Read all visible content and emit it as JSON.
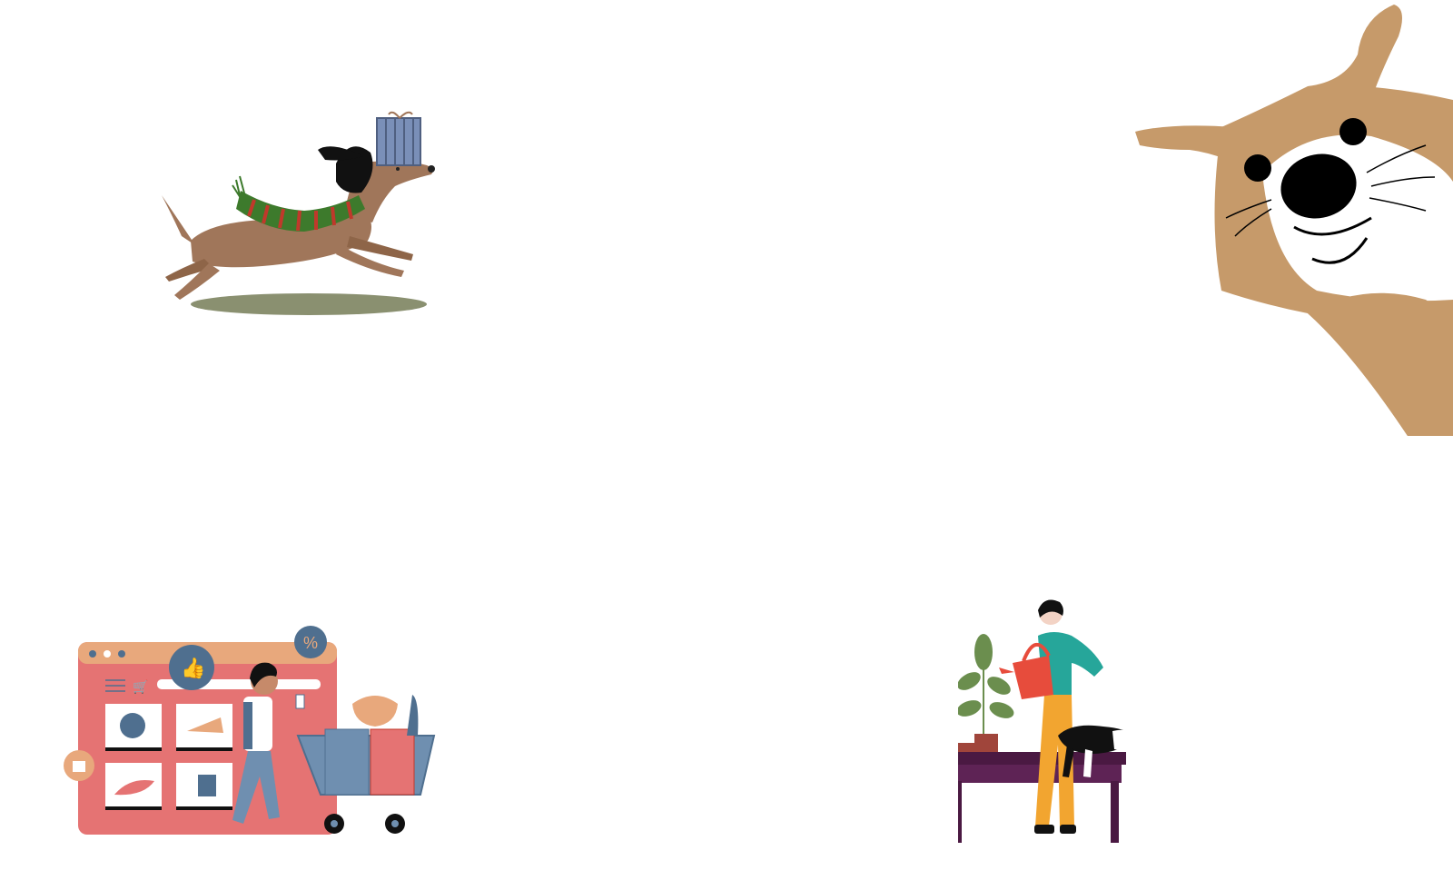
{
  "page": {
    "background": "#ffffff"
  },
  "illustrations": [
    {
      "name": "running-dog-with-gift",
      "colors": {
        "fur": "#a0765a",
        "scarf_red": "#c0392b",
        "scarf_green": "#3d7a2c",
        "gift": "#7a8fb8",
        "shadow": "#8a9070"
      }
    },
    {
      "name": "peeking-dog-face",
      "colors": {
        "fur": "#c69a6a",
        "nose": "#000000"
      }
    },
    {
      "name": "online-shopping-scene",
      "colors": {
        "window": "#e57373",
        "header": "#e8a87c",
        "accent": "#4f6f8f"
      }
    },
    {
      "name": "woman-watering-plant-with-cat",
      "colors": {
        "sweater": "#26a69a",
        "pants": "#f2a530",
        "desk": "#4a1942",
        "can": "#e74c3c",
        "leaves": "#6b8e4e"
      }
    }
  ]
}
